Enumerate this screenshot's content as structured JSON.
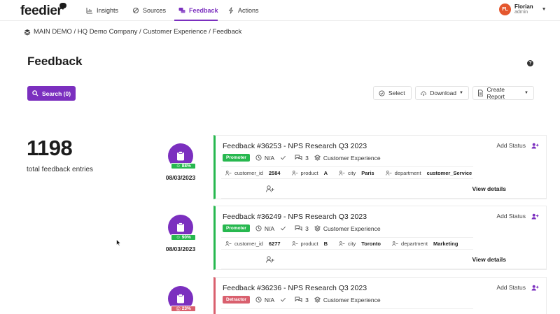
{
  "app": {
    "logo_text": "feedier"
  },
  "nav": {
    "items": [
      {
        "label": "Insights",
        "icon": "insights-icon"
      },
      {
        "label": "Sources",
        "icon": "sources-icon"
      },
      {
        "label": "Feedback",
        "icon": "feedback-icon",
        "active": true
      },
      {
        "label": "Actions",
        "icon": "actions-icon"
      }
    ]
  },
  "user": {
    "initials": "FL",
    "name": "Florian",
    "role": "admin"
  },
  "breadcrumb": {
    "text": "MAIN DEMO / HQ Demo Company / Customer Experience / Feedback"
  },
  "page": {
    "title": "Feedback",
    "help": "?"
  },
  "toolbar": {
    "search_label": "Search (0)",
    "select_label": "Select",
    "download_label": "Download",
    "create_report_label": "Create Report"
  },
  "stats": {
    "total": "1198",
    "total_label": "total feedback entries"
  },
  "feedback": [
    {
      "title": "Feedback #36253 - NPS Research Q3 2023",
      "badge": "Promoter",
      "badge_color": "#27b84f",
      "time": "N/A",
      "comments": "3",
      "category": "Customer Experience",
      "score": "88%",
      "date": "08/03/2023",
      "attributes": [
        {
          "key": "customer_id",
          "value": "2584"
        },
        {
          "key": "product",
          "value": "A"
        },
        {
          "key": "city",
          "value": "Paris"
        },
        {
          "key": "department",
          "value": "customer_Service"
        }
      ],
      "add_status": "Add Status",
      "view_details": "View details"
    },
    {
      "title": "Feedback #36249 - NPS Research Q3 2023",
      "badge": "Promoter",
      "badge_color": "#27b84f",
      "time": "N/A",
      "comments": "3",
      "category": "Customer Experience",
      "score": "90%",
      "date": "08/03/2023",
      "attributes": [
        {
          "key": "customer_id",
          "value": "6277"
        },
        {
          "key": "product",
          "value": "B"
        },
        {
          "key": "city",
          "value": "Toronto"
        },
        {
          "key": "department",
          "value": "Marketing"
        }
      ],
      "add_status": "Add Status",
      "view_details": "View details"
    },
    {
      "title": "Feedback #36236 - NPS Research Q3 2023",
      "badge": "Detractor",
      "badge_color": "#d9606e",
      "time": "N/A",
      "comments": "3",
      "category": "Customer Experience",
      "score": "23%",
      "add_status": "Add Status"
    }
  ],
  "colors": {
    "accent": "#7b2fbf",
    "promoter": "#27b84f",
    "detractor": "#d9606e"
  }
}
